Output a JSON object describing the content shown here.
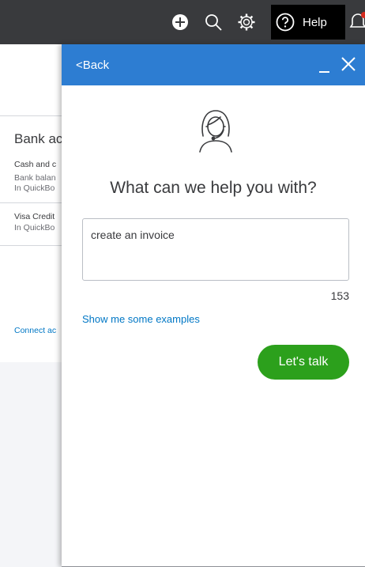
{
  "topbar": {
    "icons": [
      "plus-circle-icon",
      "search-icon",
      "gear-icon",
      "question-circle-icon",
      "bell-icon"
    ],
    "help_label": "Help",
    "notification_color": "#d52b1e"
  },
  "background": {
    "section_title": "Bank ac",
    "items": [
      {
        "name": "Cash and c",
        "line2": "Bank balan",
        "line3": "In QuickBo"
      },
      {
        "name": "Visa Credit",
        "line2": "In QuickBo"
      }
    ],
    "connect_link": "Connect ac"
  },
  "help_panel": {
    "back_label": "<Back",
    "header_color": "#2d7dd2",
    "agent_icon": "support-agent-icon",
    "heading": "What can we help you with?",
    "query_value": "create an invoice",
    "char_count": "153",
    "examples_link": "Show me some examples",
    "talk_button": "Let's talk",
    "talk_button_color": "#2ca01c"
  }
}
